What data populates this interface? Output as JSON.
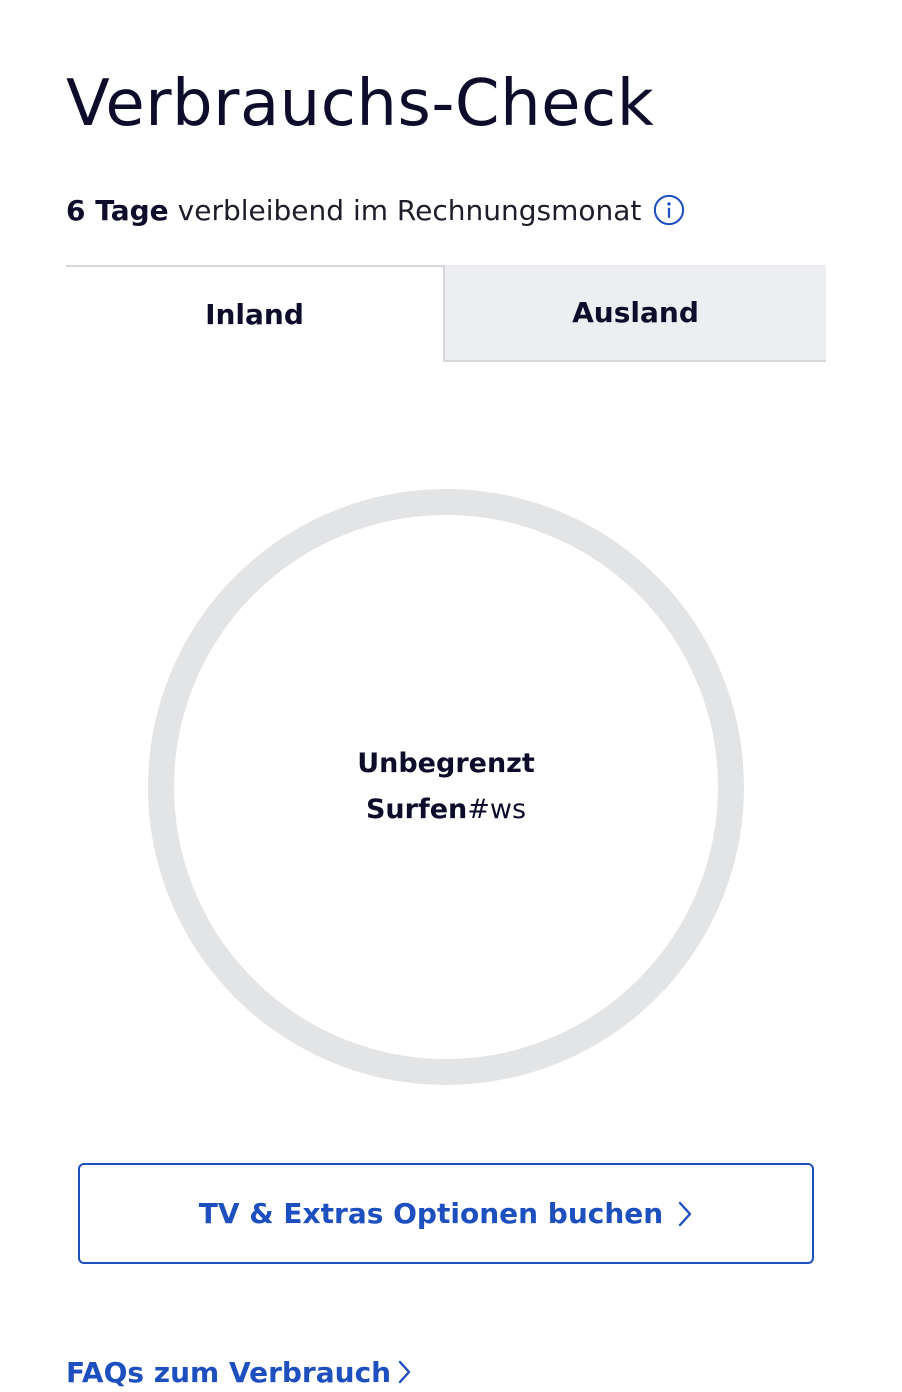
{
  "header": {
    "title": "Verbrauchs-Check"
  },
  "billing": {
    "days_remaining": "6 Tage",
    "remaining_text": "verbleibend im Rechnungsmonat",
    "info_icon": "info-icon"
  },
  "tabs": [
    {
      "label": "Inland",
      "active": true
    },
    {
      "label": "Ausland",
      "active": false
    }
  ],
  "usage": {
    "line1": "Unbegrenzt",
    "line2_bold": "Surfen",
    "line2_rest": "#ws"
  },
  "actions": {
    "options_button_label": "TV & Extras Optionen buchen",
    "faq_link_label": "FAQs zum Verbrauch",
    "chevron_icon": "chevron-right-icon"
  },
  "colors": {
    "accent": "#1e4fbf",
    "text": "#0d0d2b",
    "ring": "#e3e4e6",
    "inactive_tab": "#eceef1"
  }
}
